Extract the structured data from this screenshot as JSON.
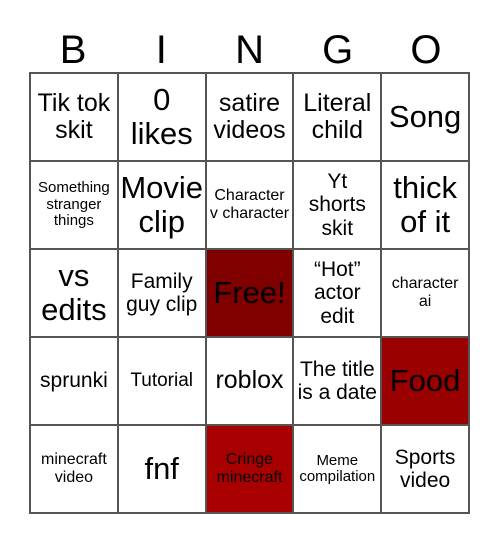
{
  "header": {
    "letters": [
      "B",
      "I",
      "N",
      "G",
      "O"
    ]
  },
  "colors": {
    "marked": "#800000",
    "grid_line": "#555555",
    "background": "#ffffff"
  },
  "cells": [
    {
      "text": "Tik tok skit",
      "marked": false
    },
    {
      "text": "0 likes",
      "marked": false
    },
    {
      "text": "satire videos",
      "marked": false
    },
    {
      "text": "Literal child",
      "marked": false
    },
    {
      "text": "Song",
      "marked": false
    },
    {
      "text": "Something stranger things",
      "marked": false
    },
    {
      "text": "Movie clip",
      "marked": false
    },
    {
      "text": "Character v character",
      "marked": false
    },
    {
      "text": "Yt shorts skit",
      "marked": false
    },
    {
      "text": "thick of it",
      "marked": false
    },
    {
      "text": "vs edits",
      "marked": false
    },
    {
      "text": "Family guy clip",
      "marked": false
    },
    {
      "text": "Free!",
      "marked": true
    },
    {
      "text": "“Hot” actor edit",
      "marked": false
    },
    {
      "text": "character ai",
      "marked": false
    },
    {
      "text": "sprunki",
      "marked": false
    },
    {
      "text": "Tutorial",
      "marked": false
    },
    {
      "text": "roblox",
      "marked": false
    },
    {
      "text": "The title is a date",
      "marked": false
    },
    {
      "text": "Food",
      "marked": true
    },
    {
      "text": "minecraft video",
      "marked": false
    },
    {
      "text": "fnf",
      "marked": false
    },
    {
      "text": "Cringe minecraft",
      "marked": true
    },
    {
      "text": "Meme compilation",
      "marked": false
    },
    {
      "text": "Sports video",
      "marked": false
    }
  ]
}
